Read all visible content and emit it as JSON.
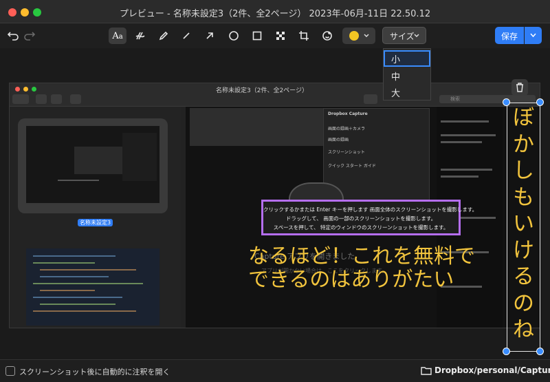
{
  "window": {
    "title": "プレビュー - 名称未設定3（2件、全2ページ） 2023年-06月-11日 22.50.12"
  },
  "toolbar": {
    "undo_icon": "undo-icon",
    "redo_icon": "redo-icon",
    "tools": [
      "text-style-icon",
      "highlighter-icon",
      "pen-icon",
      "line-icon",
      "arrow-icon",
      "ellipse-icon",
      "rectangle-icon",
      "pixelate-icon",
      "crop-icon",
      "sticker-icon"
    ],
    "color": "#f3c623",
    "size_label": "サイズ",
    "save_label": "保存"
  },
  "size_menu": {
    "options": [
      "小",
      "中",
      "大"
    ],
    "selected": "小"
  },
  "inner_window": {
    "title": "名称未設定3（2件、全2ページ）",
    "search_placeholder": "検索",
    "thumb_label": "名称未設定3",
    "panel_title": "Dropbox Capture",
    "panel_rows": [
      "画面の録画＋カメラ",
      "画面の録画",
      "スクリーンショット",
      "クイック スタート ガイド"
    ],
    "tooltip_lines": [
      "クリックするかまたは Enter キーを押します 画面全体のスクリーンショットを撮影します。",
      "ドラッグして、 画面の一部のスクリーンショットを撮影します。",
      "スペースを押して、 特定のウィンドウのスクリーンショットを撮影します。"
    ],
    "open_text": "Capture アプリを開きました",
    "open_sub": "アプリが開かない場合は、ここをクリックします。"
  },
  "annotation": {
    "lines": [
      "なるほど！これを無料で",
      "できるのはありがたい"
    ],
    "vertical": [
      "ぼ",
      "か",
      "し",
      "も",
      "い",
      "け",
      "る",
      "の",
      "ね"
    ],
    "color": "#f2c43d"
  },
  "footer": {
    "checkbox_label": "スクリーンショット後に自動的に注釈を開く",
    "checkbox_checked": false,
    "path": "Dropbox/personal/Capture"
  }
}
